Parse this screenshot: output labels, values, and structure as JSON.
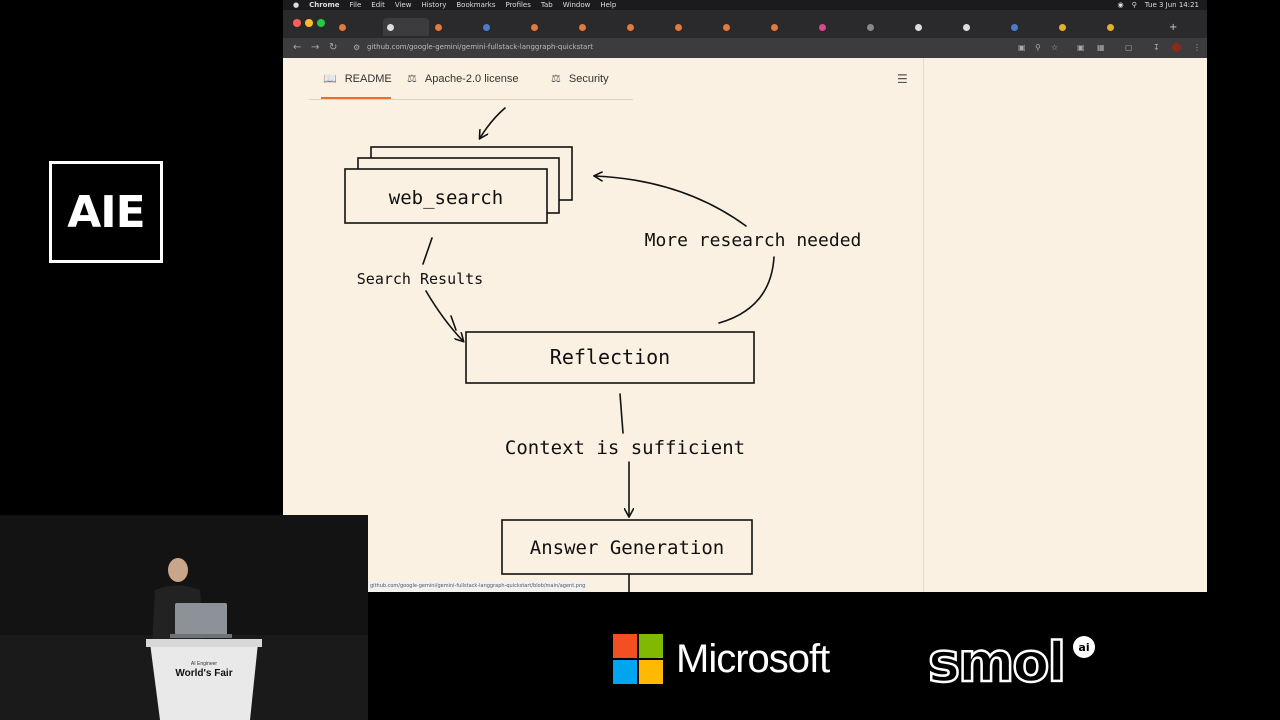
{
  "event_logo": {
    "text": "AIE"
  },
  "menubar": {
    "app": "Chrome",
    "items": [
      "File",
      "Edit",
      "View",
      "History",
      "Bookmarks",
      "Profiles",
      "Tab",
      "Window",
      "Help"
    ],
    "clock": "Tue 3 Jun 14:21"
  },
  "browser": {
    "url": "github.com/google-gemini/gemini-fullstack-langgraph-quickstart",
    "status_url": "github.com/google-gemini/gemini-fullstack-langgraph-quickstart/blob/main/agent.png"
  },
  "readme_tabs": [
    {
      "label": "README",
      "icon": "book-icon"
    },
    {
      "label": "Apache-2.0 license",
      "icon": "scale-icon"
    },
    {
      "label": "Security",
      "icon": "scale-icon"
    }
  ],
  "diagram": {
    "nodes": {
      "web_search": "web_search",
      "reflection": "Reflection",
      "answer": "Answer Generation"
    },
    "edges": {
      "search_results": "Search Results",
      "more_research": "More research needed",
      "context_sufficient": "Context is sufficient"
    }
  },
  "video": {
    "podium_text": "World's Fair",
    "podium_small": "AI Engineer"
  },
  "sponsors": {
    "microsoft": "Microsoft",
    "smol": "smol",
    "smol_badge": "ai"
  },
  "colors": {
    "accent": "#e8702a",
    "page_bg": "#faf1e2"
  }
}
